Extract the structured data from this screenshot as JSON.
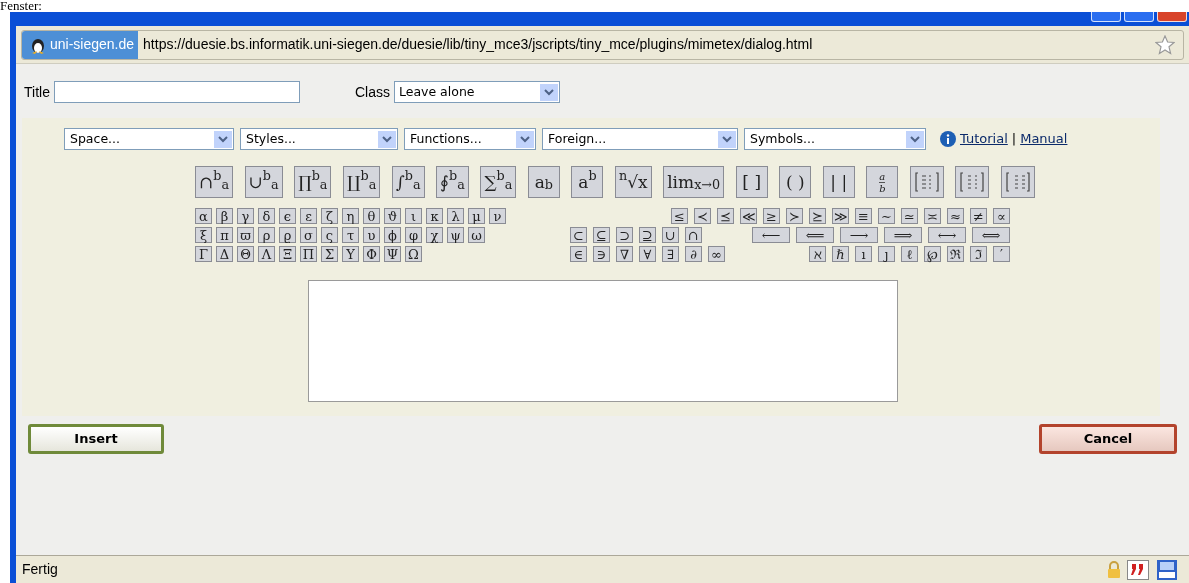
{
  "page_text": "Fenster:",
  "address_bar": {
    "site": "uni-siegen.de",
    "url": "https://duesie.bs.informatik.uni-siegen.de/duesie/lib/tiny_mce3/jscripts/tiny_mce/plugins/mimetex/dialog.html"
  },
  "form": {
    "title_label": "Title",
    "class_label": "Class",
    "class_value": "Leave alone"
  },
  "dropdowns": [
    "Space...",
    "Styles...",
    "Functions...",
    "Foreign...",
    "Symbols..."
  ],
  "links": [
    "Tutorial",
    "|",
    "Manual"
  ],
  "big_symbols": [
    {
      "kind": "text",
      "label": "∩$^{b}$$_{a}$"
    },
    {
      "kind": "text",
      "label": "∪$^{b}$$_{a}$"
    },
    {
      "kind": "text",
      "label": "∏$^{b}$$_{a}$"
    },
    {
      "kind": "text",
      "label": "∐$^{b}$$_{a}$"
    },
    {
      "kind": "text",
      "label": "∫$^{b}$$_{a}$"
    },
    {
      "kind": "text",
      "label": "∮$^{b}$$_{a}$"
    },
    {
      "kind": "text",
      "label": "∑$^{b}$$_{a}$"
    },
    {
      "kind": "text",
      "label": "a$_{b}$"
    },
    {
      "kind": "text",
      "label": "a$^{b}$"
    },
    {
      "kind": "text",
      "label": "$^{n}$√x"
    },
    {
      "kind": "text",
      "label": "lim$_{x→0}$"
    },
    {
      "kind": "text",
      "label": "[ ]"
    },
    {
      "kind": "text",
      "label": "( )"
    },
    {
      "kind": "text",
      "label": "| |"
    },
    {
      "kind": "fraction",
      "top": "a",
      "bottom": "b"
    },
    {
      "kind": "matrix_left"
    },
    {
      "kind": "matrix_center"
    },
    {
      "kind": "matrix_right"
    }
  ],
  "symbol_rows": [
    {
      "greek": [
        "α",
        "β",
        "γ",
        "δ",
        "ϵ",
        "ε",
        "ζ",
        "η",
        "θ",
        "ϑ",
        "ι",
        "κ",
        "λ",
        "μ",
        "ν"
      ],
      "groups": [
        [
          "≤",
          "≺",
          "⪯",
          "≪",
          "≥",
          "≻",
          "⪰",
          "≫",
          "≡",
          "∼",
          "≃",
          "≍",
          "≈",
          "≠",
          "∝"
        ]
      ]
    },
    {
      "greek": [
        "ξ",
        "π",
        "ϖ",
        "ρ",
        "ϱ",
        "σ",
        "ς",
        "τ",
        "υ",
        "ϕ",
        "φ",
        "χ",
        "ψ",
        "ω"
      ],
      "groups": [
        [
          "⊂",
          "⊆",
          "⊃",
          "⊇",
          "∪",
          "∩"
        ],
        [
          "⟵",
          "⟸",
          "⟶",
          "⟹",
          "⟷",
          "⟺"
        ]
      ]
    },
    {
      "greek": [
        "Γ",
        "Δ",
        "Θ",
        "Λ",
        "Ξ",
        "Π",
        "Σ",
        "Υ",
        "Φ",
        "Ψ",
        "Ω"
      ],
      "groups": [
        [
          "∈",
          "∋",
          "∇",
          "∀",
          "∃",
          "∂",
          "∞"
        ],
        [
          "ℵ",
          "ℏ",
          "ı",
          "ȷ",
          "ℓ",
          "℘",
          "ℜ",
          "ℑ",
          "′"
        ]
      ]
    }
  ],
  "buttons": {
    "insert": "Insert",
    "cancel": "Cancel"
  },
  "status_bar": {
    "text": "Fertig"
  }
}
